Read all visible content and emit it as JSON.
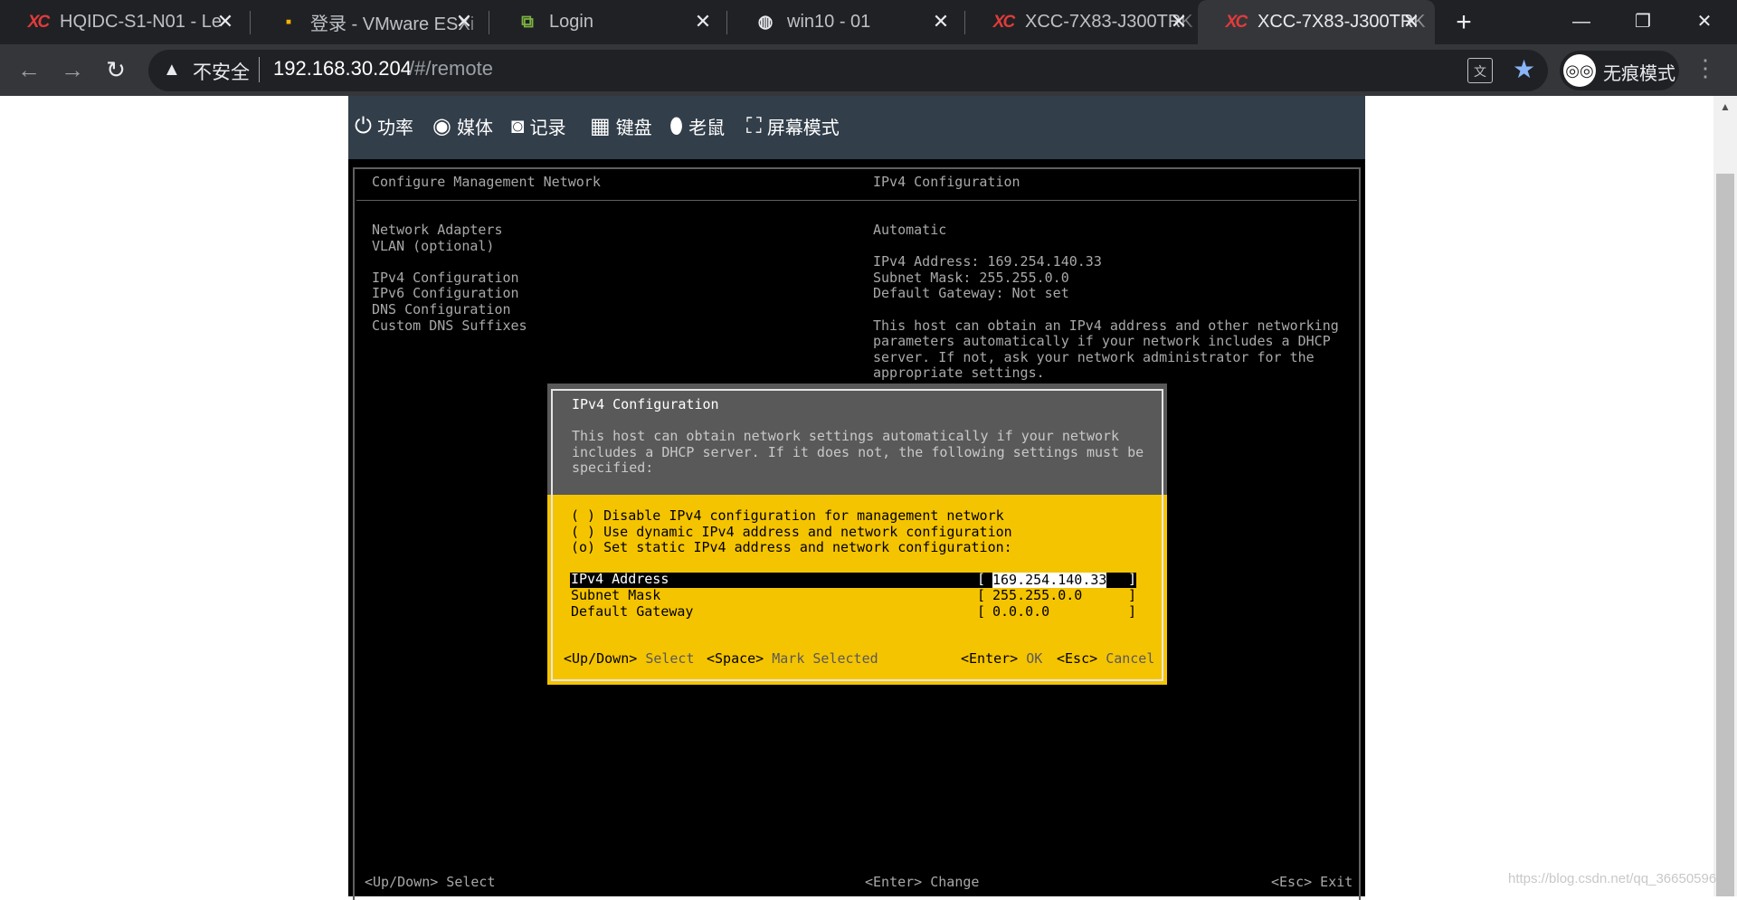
{
  "browser": {
    "tabs": [
      {
        "icon": "xcc-icon",
        "icon_glyph": "XC",
        "title": "HQIDC-S1-N01 - Le"
      },
      {
        "icon": "vmware-icon",
        "icon_glyph": "▪",
        "title": "登录 - VMware ESXi"
      },
      {
        "icon": "vsphere-icon",
        "icon_glyph": "⧉",
        "title": "Login"
      },
      {
        "icon": "globe-icon",
        "icon_glyph": "◍",
        "title": "win10 - 01"
      },
      {
        "icon": "xcc-icon",
        "icon_glyph": "XC",
        "title": "XCC-7X83-J300TRK"
      },
      {
        "icon": "xcc-icon",
        "icon_glyph": "XC",
        "title": "XCC-7X83-J300TRK",
        "active": true
      }
    ],
    "tab_close_glyph": "✕",
    "new_tab_glyph": "+",
    "window_controls": {
      "minimize": "—",
      "restore": "❐",
      "close": "✕"
    },
    "nav": {
      "back": "←",
      "forward": "→",
      "reload": "↻"
    },
    "address": {
      "security_label": "不安全",
      "host": "192.168.30.204",
      "path": "/#/remote"
    },
    "translate_glyph": "文",
    "star_glyph": "★",
    "incognito_glyph": "◎◎",
    "incognito_label": "无痕模式",
    "menu_glyph": "⋮",
    "scroll_up_glyph": "▲"
  },
  "console_toolbar": [
    {
      "icon": "power-icon",
      "glyph": "⏻",
      "label": "功率"
    },
    {
      "icon": "media-icon",
      "glyph": "◉",
      "label": "媒体"
    },
    {
      "icon": "camera-icon",
      "glyph": "◙",
      "label": "记录"
    },
    {
      "icon": "keyboard-icon",
      "glyph": "▦",
      "label": "键盘"
    },
    {
      "icon": "mouse-icon",
      "glyph": "⬮",
      "label": "老鼠"
    },
    {
      "icon": "fullscreen-icon",
      "glyph": "⛶",
      "label": "屏幕模式"
    }
  ],
  "dcui": {
    "left_title": "Configure Management Network",
    "right_title": "IPv4 Configuration",
    "menu": [
      "Network Adapters",
      "VLAN (optional)",
      "",
      "IPv4 Configuration",
      "IPv6 Configuration",
      "DNS Configuration",
      "Custom DNS Suffixes"
    ],
    "info": {
      "mode": "Automatic",
      "ipv4_address": "IPv4 Address: 169.254.140.33",
      "subnet_mask": "Subnet Mask: 255.255.0.0",
      "gateway": "Default Gateway: Not set",
      "description": [
        "This host can obtain an IPv4 address and other networking",
        "parameters automatically if your network includes a DHCP",
        "server. If not, ask your network administrator for the",
        "appropriate settings."
      ]
    },
    "footer": {
      "left": "<Up/Down> Select",
      "center": "<Enter> Change",
      "right": "<Esc> Exit"
    }
  },
  "dialog": {
    "title": "IPv4 Configuration",
    "description": [
      "This host can obtain network settings automatically if your network",
      "includes a DHCP server. If it does not, the following settings must be",
      "specified:"
    ],
    "options": [
      {
        "mark": "( )",
        "label": "Disable IPv4 configuration for management network"
      },
      {
        "mark": "( )",
        "label": "Use dynamic IPv4 address and network configuration"
      },
      {
        "mark": "(o)",
        "label": "Set static IPv4 address and network configuration:"
      }
    ],
    "fields": [
      {
        "label": "IPv4 Address",
        "value": "169.254.140.33"
      },
      {
        "label": "Subnet Mask",
        "value": "255.255.0.0"
      },
      {
        "label": "Default Gateway",
        "value": "0.0.0.0"
      }
    ],
    "bracket_open": "[",
    "bracket_close": "]",
    "hints": {
      "updown_key": "<Up/Down>",
      "updown_action": "Select",
      "space_key": "<Space>",
      "space_action": "Mark Selected",
      "enter_key": "<Enter>",
      "enter_action": "OK",
      "esc_key": "<Esc>",
      "esc_action": "Cancel"
    }
  },
  "watermark": "https://blog.csdn.net/qq_36650596"
}
